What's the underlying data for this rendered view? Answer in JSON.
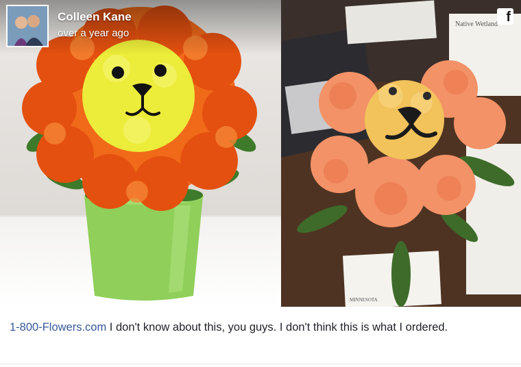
{
  "post": {
    "author_name": "Colleen Kane",
    "timestamp": "over a year ago",
    "brand_icon": "facebook-icon",
    "caption_link": "1-800-Flowers.com",
    "caption_text": " I don't know about this, you guys. I don't think this is what I ordered."
  },
  "photos": {
    "right_note_text": "Native Wetland",
    "card_text": "MINNESOTA"
  },
  "colors": {
    "link": "#365899",
    "text": "#1d2129",
    "orange": "#f06a1a",
    "yellow": "#ecec3a",
    "pot_green": "#8fcf5a"
  }
}
